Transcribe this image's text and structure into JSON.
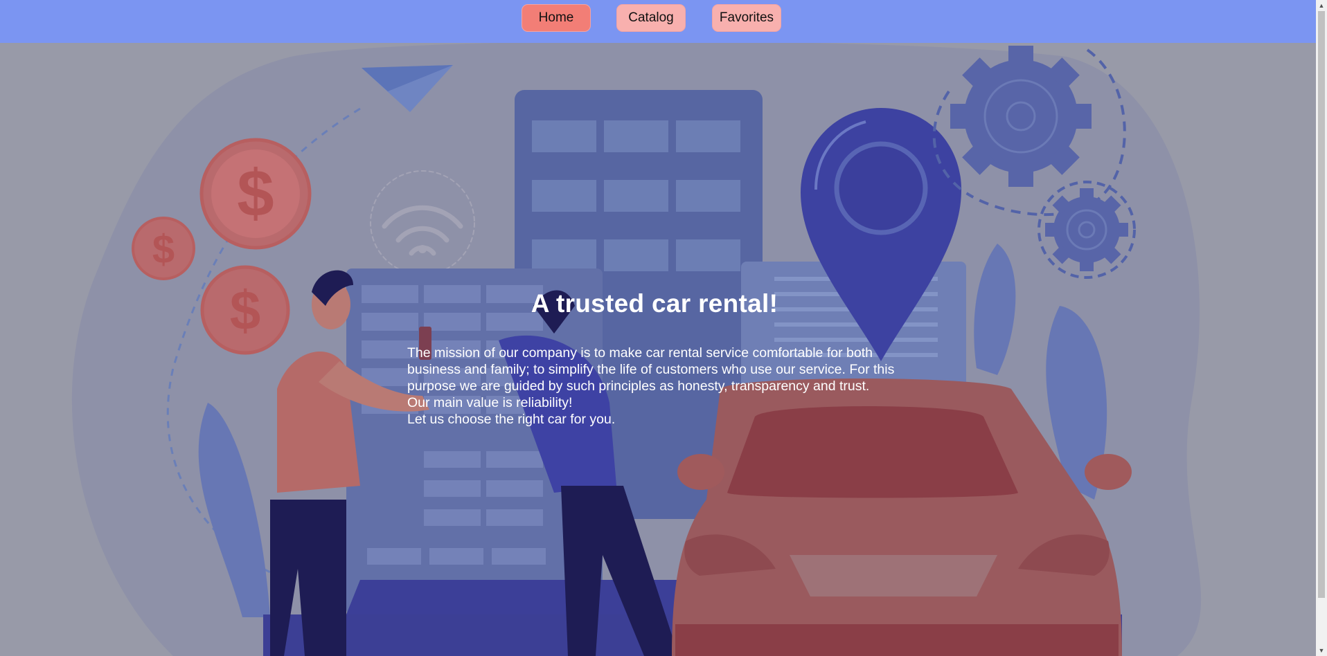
{
  "nav": {
    "home": "Home",
    "catalog": "Catalog",
    "favorites": "Favorites"
  },
  "hero": {
    "title": "A trusted car rental!",
    "paragraph_1": "The mission of our company is to make car rental service comfortable for both business and family; to simplify the life of customers who use our service. For this purpose we are guided by such principles as honesty, transparency and trust.",
    "paragraph_2": "Our main value is reliability!",
    "paragraph_3": "Let us choose the right car for you.",
    "illustration": [
      "paper-plane-icon",
      "dollar-coin-icon",
      "wifi-icon",
      "building-icon",
      "location-pin-icon",
      "gear-icon",
      "person-with-phone",
      "car-icon",
      "leaf-plant"
    ]
  },
  "colors": {
    "navbar": "#7b95f2",
    "home_button": "#f27e76",
    "nav_button": "#f8b0ae",
    "hero_overlay": "#989aa8",
    "text": "#ffffff"
  }
}
